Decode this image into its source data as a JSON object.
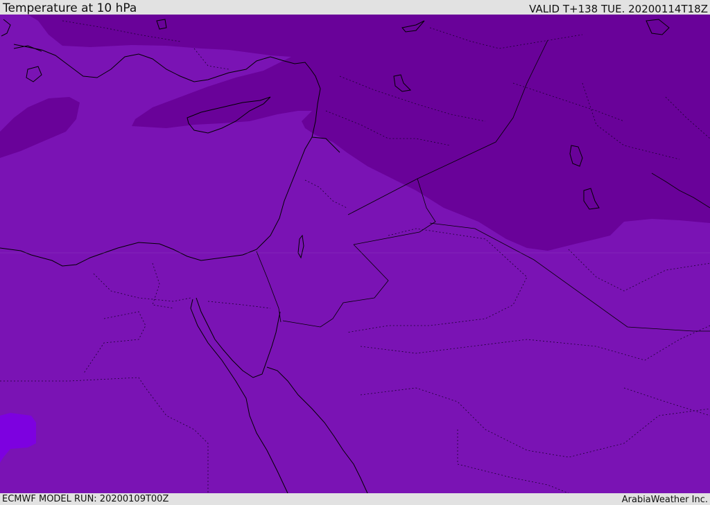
{
  "header": {
    "title": "Temperature at 10 hPa",
    "valid": "VALID T+138 TUE. 20200114T18Z"
  },
  "footer": {
    "model_run": "ECMWF MODEL RUN: 20200109T00Z",
    "credit": "ArabiaWeather Inc."
  },
  "map": {
    "colors": {
      "base_fill": "#7a13b4",
      "cold_fill": "#690299",
      "warm_fill": "#7d01e0",
      "coastline": "#000000",
      "borders": "#000000"
    }
  }
}
